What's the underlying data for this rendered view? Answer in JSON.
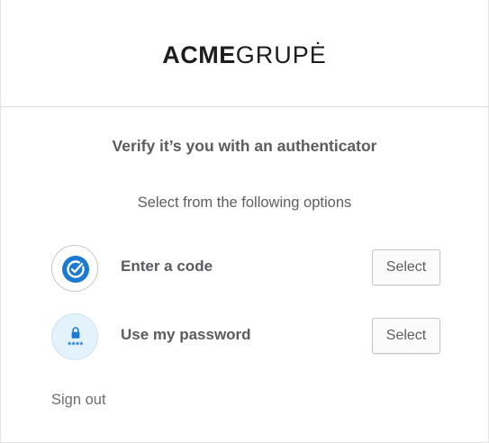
{
  "brand": {
    "logo_bold": "ACME",
    "logo_light": "GRUPĖ"
  },
  "title": "Verify it’s you with an authenticator",
  "subtitle": "Select from the following options",
  "options": [
    {
      "label": "Enter a code",
      "icon": "okta-verify-check-icon",
      "button": "Select"
    },
    {
      "label": "Use my password",
      "icon": "password-lock-icon",
      "icon_text": "****",
      "button": "Select"
    }
  ],
  "sign_out": "Sign out",
  "colors": {
    "accent_blue": "#1b7ad2",
    "text": "#5d5d62",
    "password_icon_bg": "#e3f2fb"
  }
}
